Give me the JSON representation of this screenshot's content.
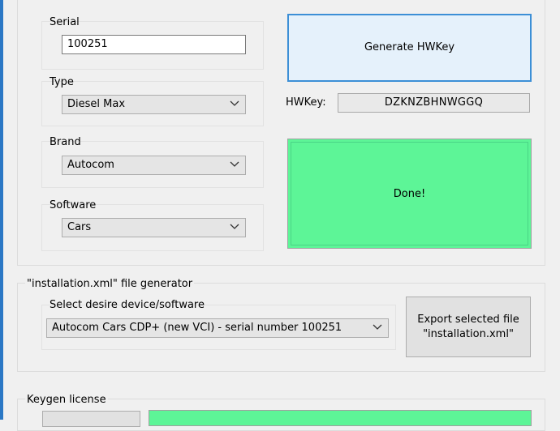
{
  "hw_group": {
    "serial_label": "Serial",
    "serial_value": "100251",
    "type_label": "Type",
    "type_value": "Diesel Max",
    "brand_label": "Brand",
    "brand_value": "Autocom",
    "software_label": "Software",
    "software_value": "Cars",
    "generate_button": "Generate HWKey",
    "hwkey_label": "HWKey:",
    "hwkey_value": "DZKNZBHNWGGQ",
    "status_text": "Done!"
  },
  "installation": {
    "title": "\"installation.xml\" file generator",
    "select_label": "Select desire device/software",
    "select_value": "Autocom Cars CDP+ (new VCI) - serial number 100251",
    "export_line1": "Export selected file",
    "export_line2": "\"installation.xml\""
  },
  "keygen": {
    "title": "Keygen license"
  },
  "colors": {
    "accent_blue": "#3c8fd6",
    "status_green": "#5df597",
    "window_bg": "#f0f0f0"
  },
  "icons": {
    "dropdown": "chevron-down-icon"
  }
}
